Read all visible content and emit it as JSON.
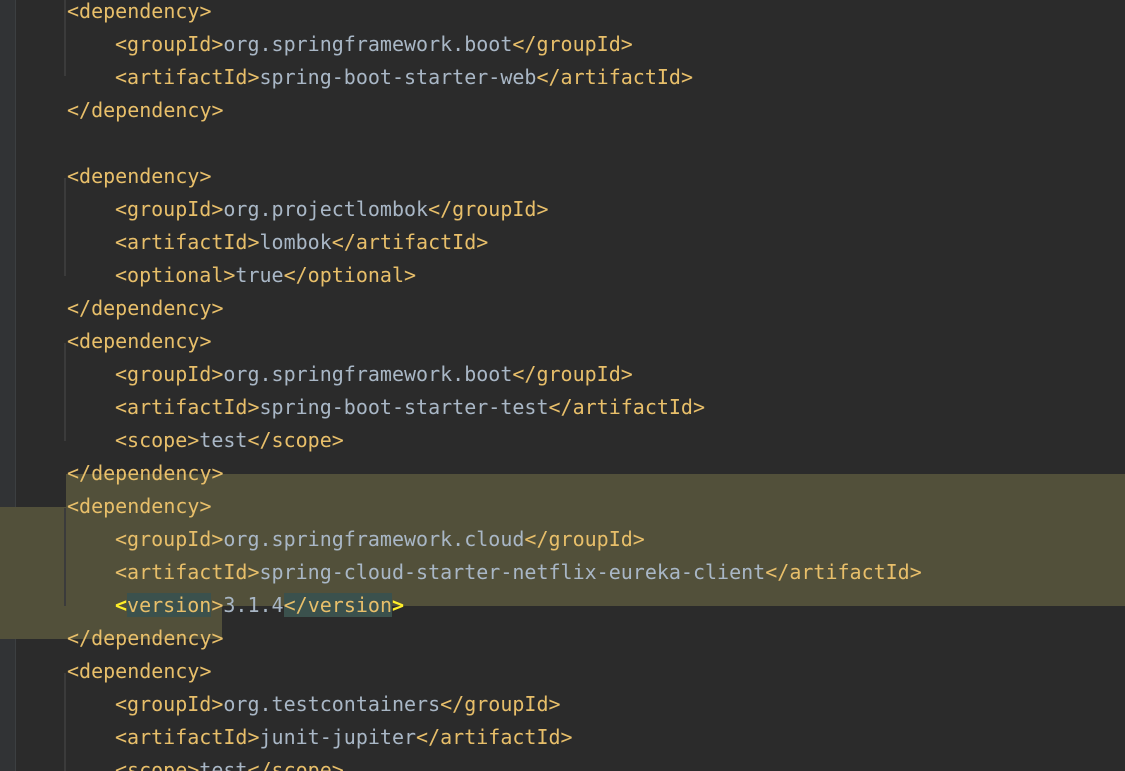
{
  "editor": {
    "language": "xml",
    "lines": [
      {
        "indent": 1,
        "open": "<dependency>",
        "text": "",
        "close": ""
      },
      {
        "indent": 2,
        "open": "<groupId>",
        "text": "org.springframework.boot",
        "close": "</groupId>"
      },
      {
        "indent": 2,
        "open": "<artifactId>",
        "text": "spring-boot-starter-web",
        "close": "</artifactId>"
      },
      {
        "indent": 1,
        "open": "</dependency>",
        "text": "",
        "close": ""
      },
      {
        "indent": 0,
        "open": "",
        "text": "",
        "close": ""
      },
      {
        "indent": 1,
        "open": "<dependency>",
        "text": "",
        "close": ""
      },
      {
        "indent": 2,
        "open": "<groupId>",
        "text": "org.projectlombok",
        "close": "</groupId>"
      },
      {
        "indent": 2,
        "open": "<artifactId>",
        "text": "lombok",
        "close": "</artifactId>"
      },
      {
        "indent": 2,
        "open": "<optional>",
        "text": "true",
        "close": "</optional>"
      },
      {
        "indent": 1,
        "open": "</dependency>",
        "text": "",
        "close": ""
      },
      {
        "indent": 1,
        "open": "<dependency>",
        "text": "",
        "close": ""
      },
      {
        "indent": 2,
        "open": "<groupId>",
        "text": "org.springframework.boot",
        "close": "</groupId>"
      },
      {
        "indent": 2,
        "open": "<artifactId>",
        "text": "spring-boot-starter-test",
        "close": "</artifactId>"
      },
      {
        "indent": 2,
        "open": "<scope>",
        "text": "test",
        "close": "</scope>"
      },
      {
        "indent": 1,
        "open": "</dependency>",
        "text": "",
        "close": ""
      },
      {
        "indent": 1,
        "open": "<dependency>",
        "text": "",
        "close": ""
      },
      {
        "indent": 2,
        "open": "<groupId>",
        "text": "org.springframework.cloud",
        "close": "</groupId>"
      },
      {
        "indent": 2,
        "open": "<artifactId>",
        "text": "spring-cloud-starter-netflix-eureka-client",
        "close": "</artifactId>"
      },
      {
        "indent": 2,
        "open": "<version>",
        "text": "3.1.4",
        "close": "</version>",
        "matched": true
      },
      {
        "indent": 1,
        "open": "</dependency>",
        "text": "",
        "close": ""
      },
      {
        "indent": 1,
        "open": "<dependency>",
        "text": "",
        "close": ""
      },
      {
        "indent": 2,
        "open": "<groupId>",
        "text": "org.testcontainers",
        "close": "</groupId>"
      },
      {
        "indent": 2,
        "open": "<artifactId>",
        "text": "junit-jupiter",
        "close": "</artifactId>"
      },
      {
        "indent": 2,
        "open": "<scope>",
        "text": "test",
        "close": "</scope>"
      }
    ]
  },
  "colors": {
    "background": "#2b2b2b",
    "tag": "#e8bf6a",
    "text": "#a9b7c6",
    "selection": "#52503a",
    "matched_tag": "#3b514d",
    "matched_bracket": "#ffef28"
  }
}
